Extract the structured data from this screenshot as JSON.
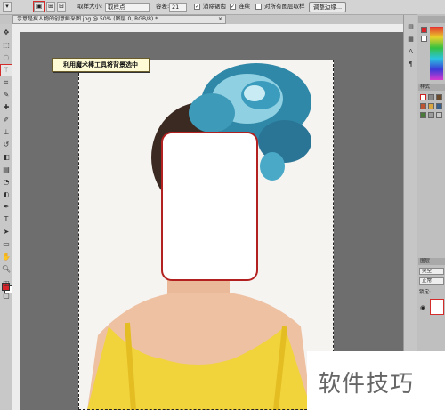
{
  "options_bar": {
    "tool_icon": "magic-wand-icon",
    "sample_size_label": "取样大小:",
    "sample_size_value": "取样点",
    "tolerance_label": "容差:",
    "tolerance_value": "21",
    "anti_alias_label": "消除锯齿",
    "anti_alias_checked": "✓",
    "contiguous_label": "连续",
    "contiguous_checked": "✓",
    "sample_all_label": "对所有图层取样",
    "refine_edge_label": "调整边缘..."
  },
  "document_tab": {
    "title": "示意是拟人物的创意鲜采图.jpg @ 50% (图层 0, RGB/8) *",
    "close": "×"
  },
  "callout": {
    "text": "利用魔术棒工具将背景选中"
  },
  "right_panel": {
    "styles_tab": "样式",
    "layers_tab": "图层",
    "layer_kind": "类型",
    "blend_mode": "正常",
    "lock_label": "锁定:"
  },
  "watermark": {
    "text": "软件技巧"
  },
  "colors": {
    "foreground": "#d8232a",
    "highlight": "#d42b2b",
    "callout_bg": "#fffbd5"
  }
}
